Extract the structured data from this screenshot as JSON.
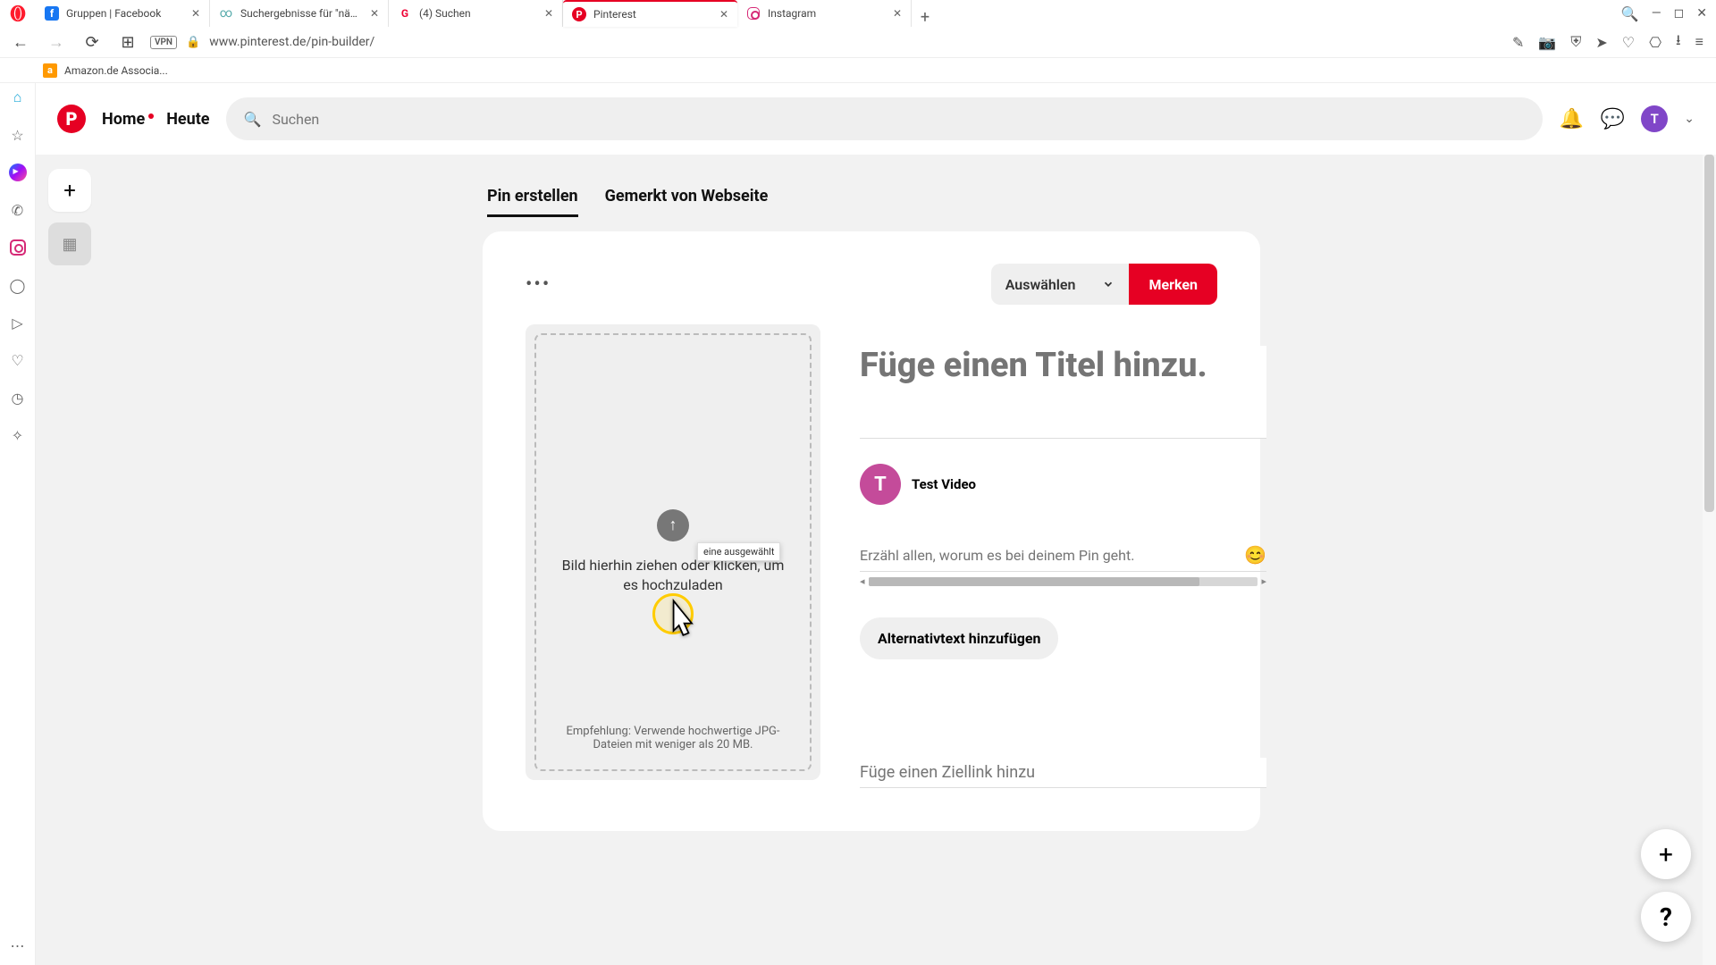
{
  "browser": {
    "tabs": [
      {
        "title": "Gruppen | Facebook",
        "favicon_color": "#1877f2",
        "favicon_letter": "f"
      },
      {
        "title": "Suchergebnisse für \"nähen\"",
        "favicon_color": "#5aa",
        "favicon_letter": "∞"
      },
      {
        "title": "(4) Suchen",
        "favicon_color": "#e03",
        "favicon_letter": "G"
      },
      {
        "title": "Pinterest",
        "favicon_color": "#e60023",
        "favicon_letter": "P"
      },
      {
        "title": "Instagram",
        "favicon_color": "#d62976",
        "favicon_letter": "◯"
      }
    ],
    "active_tab_index": 3,
    "url": "www.pinterest.de/pin-builder/",
    "vpn": "VPN",
    "bookmark": "Amazon.de Associa..."
  },
  "pinterest": {
    "nav": {
      "home": "Home",
      "today": "Heute"
    },
    "search_placeholder": "Suchen",
    "avatar_letter": "T",
    "create_tabs": {
      "create": "Pin erstellen",
      "from_web": "Gemerkt von Webseite"
    },
    "board_select": "Auswählen",
    "save_button": "Merken",
    "upload": {
      "text": "Bild hierhin ziehen oder klicken, um es hochzuladen",
      "hint": "Empfehlung: Verwende hochwertige JPG-Dateien mit weniger als 20 MB.",
      "tooltip": "eine ausgewählt"
    },
    "form": {
      "title_placeholder": "Füge einen Titel hinzu.",
      "user_name": "Test Video",
      "user_initial": "T",
      "desc_placeholder": "Erzähl allen, worum es bei deinem Pin geht.",
      "alt_button": "Alternativtext hinzufügen",
      "link_placeholder": "Füge einen Ziellink hinzu"
    },
    "fab": {
      "plus": "+",
      "help": "?"
    }
  }
}
